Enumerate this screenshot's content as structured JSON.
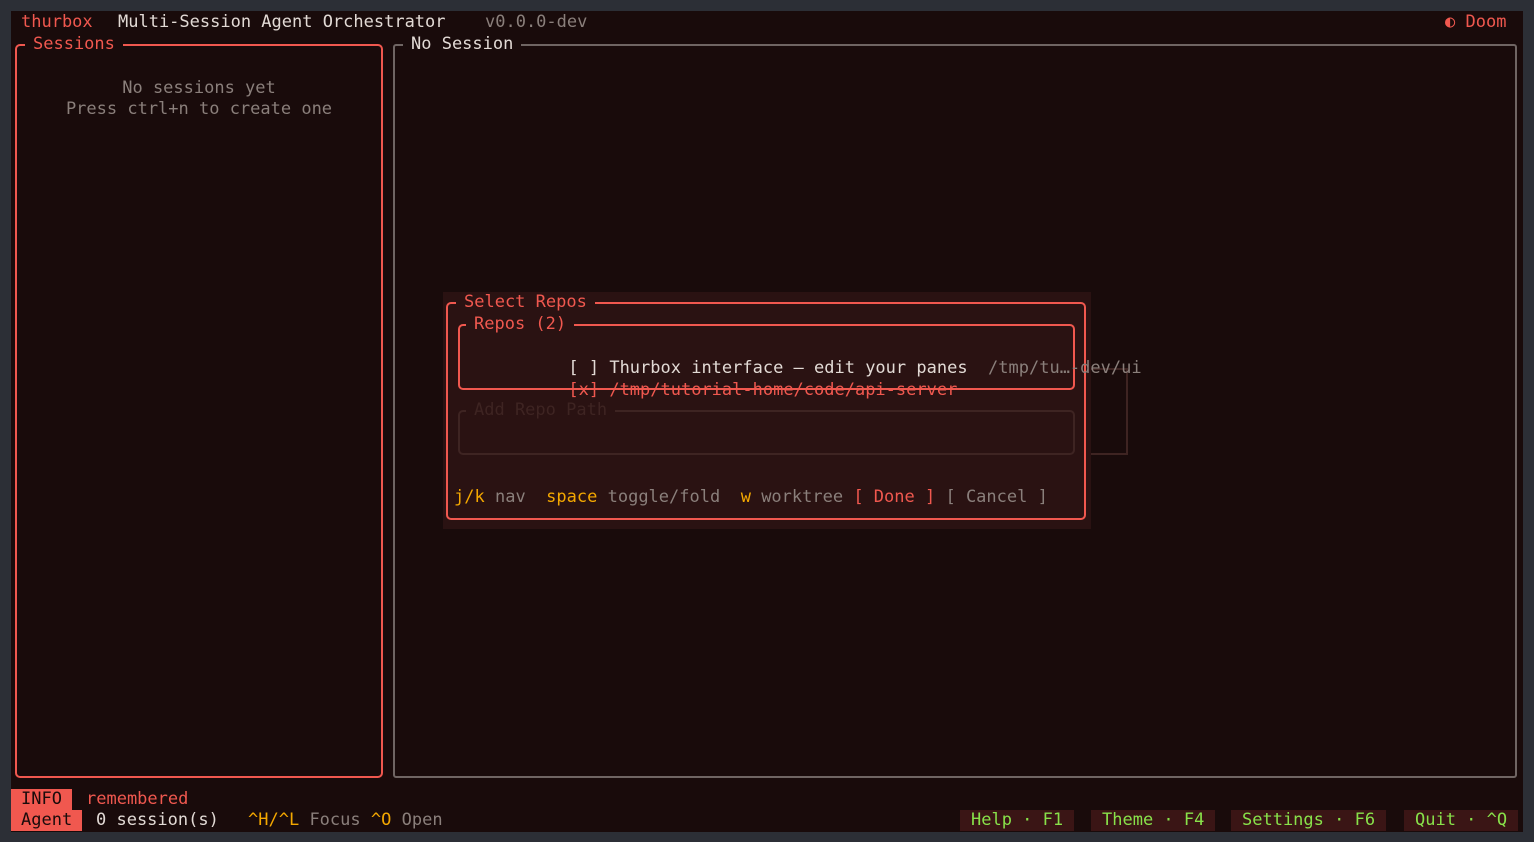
{
  "header": {
    "app_name": "thurbox",
    "subtitle": "Multi-Session Agent Orchestrator",
    "version": "v0.0.0-dev",
    "theme_icon": "moon-icon",
    "theme_glyph": "◐",
    "theme_name": "Doom"
  },
  "sessions_panel": {
    "title": "Sessions",
    "empty_line1": "No sessions yet",
    "empty_line2": "Press ctrl+n to create one"
  },
  "main_panel": {
    "title": "No Session"
  },
  "modal": {
    "title": "Select Repos",
    "repos_title": "Repos (2)",
    "repos": [
      {
        "checkbox": "[ ]",
        "name": "Thurbox interface — edit your panes",
        "path": "/tmp/tu…-dev/ui"
      },
      {
        "checkbox": "[x]",
        "name": "/tmp/tutorial-home/code/api-server",
        "path": ""
      }
    ],
    "add_repo": {
      "placeholder": "Add Repo Path",
      "value": ""
    },
    "hints": [
      {
        "key": "j/k",
        "label": "nav"
      },
      {
        "key": "space",
        "label": "toggle/fold"
      },
      {
        "key": "w",
        "label": "worktree"
      }
    ],
    "done_label": "[ Done ]",
    "cancel_label": "[ Cancel ]"
  },
  "status": {
    "level": "INFO",
    "message": "remembered",
    "mode": "Agent",
    "session_count": "0 session(s)",
    "focus_key": "^H/^L",
    "focus_label": "Focus",
    "open_key": "^O",
    "open_label": "Open"
  },
  "footer_buttons": [
    {
      "label": "Help · F1"
    },
    {
      "label": "Theme · F4"
    },
    {
      "label": "Settings · F6"
    },
    {
      "label": "Quit · ^Q"
    }
  ],
  "colors": {
    "background": "#190b0b",
    "accent_red": "#f0584f",
    "key_yellow": "#f4a800",
    "button_green": "#88e14a",
    "muted_grey": "#8a7f7b"
  }
}
